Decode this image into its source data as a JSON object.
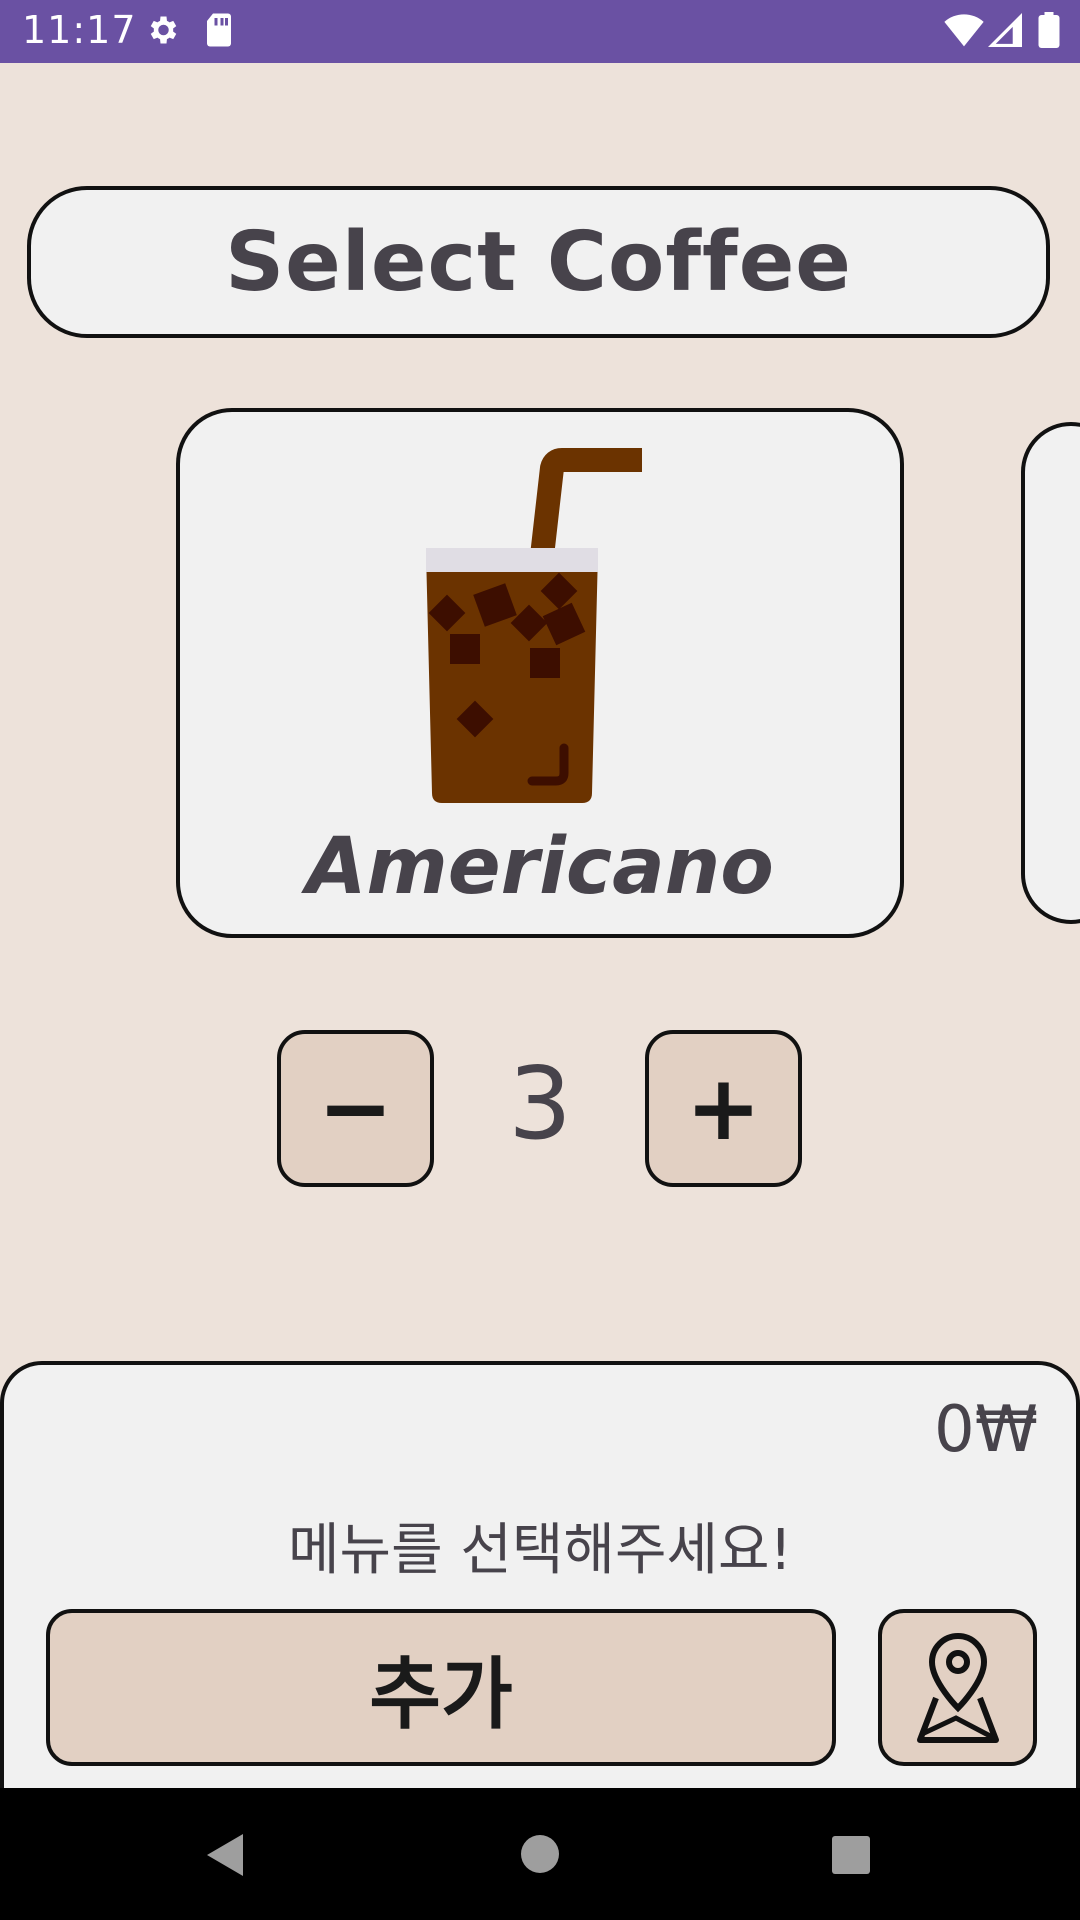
{
  "status_bar": {
    "time": "11:17",
    "background": "#6a51a3",
    "icons": [
      "gear-icon",
      "sd-card-icon",
      "wifi-icon",
      "signal-icon",
      "battery-icon"
    ]
  },
  "header": {
    "title": "Select Coffee"
  },
  "menu_card": {
    "name": "Americano",
    "image": "iced-americano-icon"
  },
  "quantity": {
    "minus_label": "−",
    "value": "3",
    "plus_label": "+"
  },
  "summary": {
    "price": "0₩",
    "message": "메뉴를 선택해주세요!",
    "add_label": "추가",
    "map_icon": "map-pin-icon"
  },
  "colors": {
    "background": "#ede2da",
    "card": "#f1f1f1",
    "button": "#e2d0c3",
    "text": "#47434b",
    "coffee": "#6b3300"
  },
  "nav_bar": {
    "icons": [
      "back-icon",
      "home-icon",
      "recents-icon"
    ]
  }
}
